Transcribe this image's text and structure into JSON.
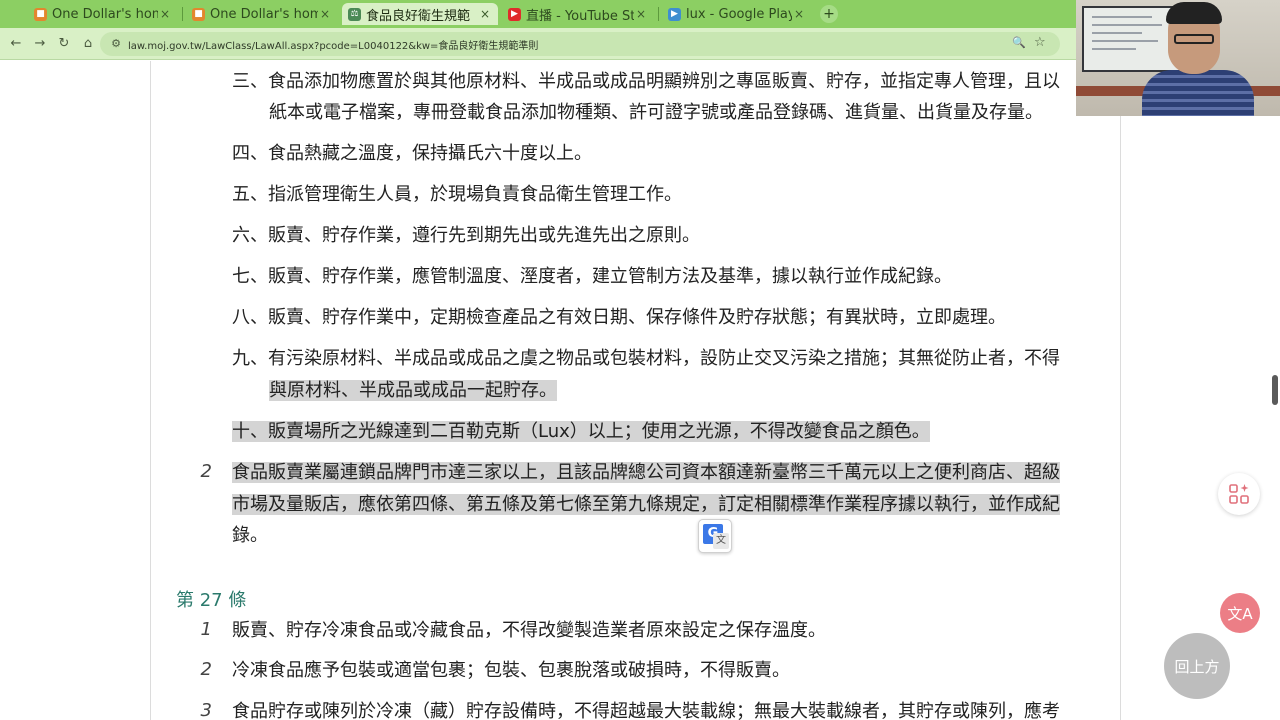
{
  "browser": {
    "tabs": [
      {
        "title": "One Dollar's hom",
        "favicon": "orange-bookmark-icon",
        "favicon_color": "#e2872e"
      },
      {
        "title": "One Dollar's hom",
        "favicon": "orange-bookmark-icon",
        "favicon_color": "#e2872e"
      },
      {
        "title": "食品良好衛生規範",
        "favicon": "law-site-icon",
        "favicon_color": "#4b8a56",
        "active": true
      },
      {
        "title": "直播 - YouTube St",
        "favicon": "youtube-icon",
        "favicon_color": "#e02b2b"
      },
      {
        "title": "lux - Google Play",
        "favicon": "google-play-icon",
        "favicon_color": "#3e8ed0"
      }
    ],
    "new_tab_label": "+",
    "close_glyph": "×",
    "url": "law.moj.gov.tw/LawClass/LawAll.aspx?pcode=L0040122&kw=食品良好衛生規範準則",
    "accent_color": "#8ccf63"
  },
  "law": {
    "items": [
      {
        "label": "三、",
        "lines": [
          "食品添加物應置於與其他原材料、半成品或成品明顯辨別之專區販賣、貯存，並指定專人管理，且以",
          "紙本或電子檔案，專冊登載食品添加物種類、許可證字號或產品登錄碼、進貨量、出貨量及存量。"
        ]
      },
      {
        "label": "四、",
        "lines": [
          "食品熱藏之溫度，保持攝氏六十度以上。"
        ]
      },
      {
        "label": "五、",
        "lines": [
          "指派管理衛生人員，於現場負責食品衛生管理工作。"
        ]
      },
      {
        "label": "六、",
        "lines": [
          "販賣、貯存作業，遵行先到期先出或先進先出之原則。"
        ]
      },
      {
        "label": "七、",
        "lines": [
          "販賣、貯存作業，應管制溫度、溼度者，建立管制方法及基準，據以執行並作成紀錄。"
        ]
      },
      {
        "label": "八、",
        "lines": [
          "販賣、貯存作業中，定期檢查產品之有效日期、保存條件及貯存狀態；有異狀時，立即處理。"
        ]
      },
      {
        "label": "九、",
        "lines": [
          "有污染原材料、半成品或成品之虞之物品或包裝材料，設防止交叉污染之措施；其無從防止者，不得",
          "與原材料、半成品或成品一起貯存。"
        ]
      },
      {
        "label": "十、",
        "lines": [
          "販賣場所之光線達到二百勒克斯（Lux）以上；使用之光源，不得改變食品之顏色。"
        ]
      }
    ],
    "para2": {
      "number": "2",
      "lines": [
        "食品販賣業屬連鎖品牌門市達三家以上，且該品牌總公司資本額達新臺幣三千萬元以上之便利商店、超級",
        "市場及量販店，應依第四條、第五條及第七條至第九條規定，訂定相關標準作業程序據以執行，並作成紀",
        "錄。"
      ]
    },
    "article27": {
      "title": "第 27 條",
      "paragraphs": [
        {
          "number": "1",
          "text": "販賣、貯存冷凍食品或冷藏食品，不得改變製造業者原來設定之保存溫度。"
        },
        {
          "number": "2",
          "text": "冷凍食品應予包裝或適當包裹；包裝、包裹脫落或破損時，不得販賣。"
        },
        {
          "number": "3",
          "text": "食品貯存或陳列於冷凍（藏）貯存設備時，不得超越最大裝載線；無最大裝載線者，其貯存或陳列，應考"
        }
      ]
    }
  },
  "widgets": {
    "back_to_top_label": "回上方",
    "translate_popup_g": "G",
    "translate_popup_w": "文",
    "translate_fab_glyph": "文A"
  }
}
